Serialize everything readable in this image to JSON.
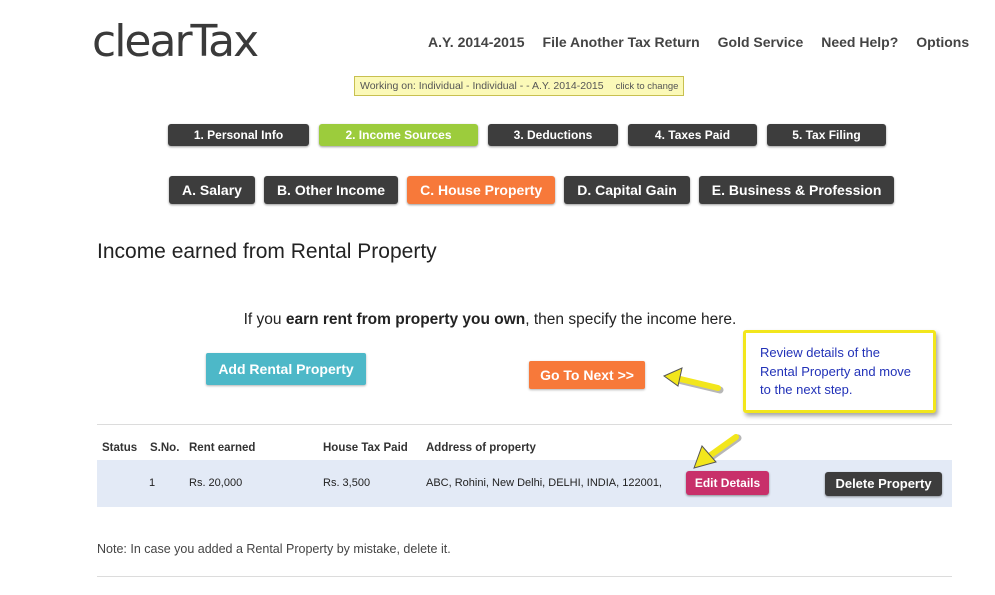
{
  "logo": "clearTax",
  "topnav": [
    "A.Y. 2014-2015",
    "File Another Tax Return",
    "Gold Service",
    "Need Help?",
    "Options"
  ],
  "working": {
    "text": "Working on: Individual - Individual - - A.Y. 2014-2015",
    "change": "click to change"
  },
  "steps": [
    {
      "label": "1. Personal Info"
    },
    {
      "label": "2. Income Sources"
    },
    {
      "label": "3. Deductions"
    },
    {
      "label": "4. Taxes Paid"
    },
    {
      "label": "5. Tax Filing"
    }
  ],
  "subtabs": [
    {
      "label": "A. Salary"
    },
    {
      "label": "B. Other Income"
    },
    {
      "label": "C. House Property"
    },
    {
      "label": "D. Capital Gain"
    },
    {
      "label": "E. Business & Profession"
    }
  ],
  "page_title": "Income earned from Rental Property",
  "intro": {
    "prefix": "If you ",
    "bold": "earn rent from property you own",
    "suffix": ", then specify the income here."
  },
  "buttons": {
    "add": "Add Rental Property",
    "next": "Go To Next >>",
    "edit": "Edit Details",
    "delete": "Delete Property"
  },
  "callout": "Review details of the Rental Property and move to the next step.",
  "table": {
    "headers": [
      "Status",
      "S.No.",
      "Rent earned",
      "House Tax Paid",
      "Address of property"
    ],
    "rows": [
      {
        "status": "",
        "sno": "1",
        "rent": "Rs. 20,000",
        "tax": "Rs. 3,500",
        "address": "ABC, Rohini, New Delhi, DELHI, INDIA, 122001,"
      }
    ]
  },
  "note": "Note: In case you added a Rental Property by mistake, delete it.",
  "colors": {
    "active_step": "#9ccc3c",
    "active_subtab": "#f7793a",
    "button_dark": "#3d3d3d",
    "add_button": "#4db8c8",
    "edit_button": "#c8306a",
    "callout_border": "#f2e61c",
    "callout_text": "#2232b8",
    "row_bg": "#e3eaf6"
  }
}
